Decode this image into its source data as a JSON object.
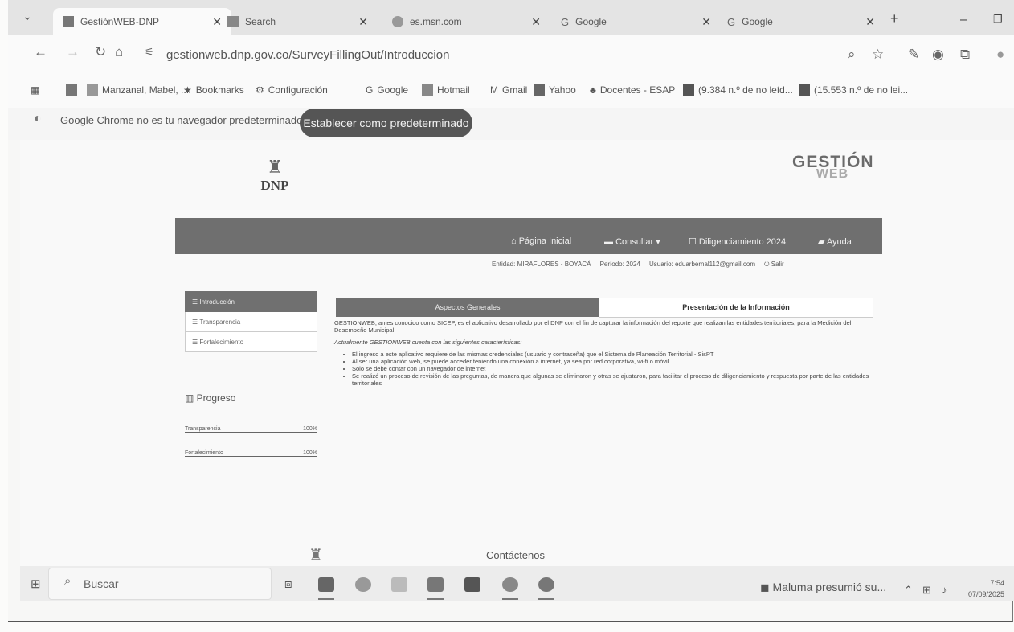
{
  "browser": {
    "tabs": [
      {
        "label": "GestiónWEB-DNP",
        "icon": "gestionweb-favicon"
      },
      {
        "label": "Search",
        "icon": "search-favicon"
      },
      {
        "label": "es.msn.com",
        "icon": "msn-favicon"
      },
      {
        "label": "Google",
        "icon": "google-favicon"
      },
      {
        "label": "Google",
        "icon": "google-favicon"
      }
    ],
    "url": "gestionweb.dnp.gov.co/SurveyFillingOut/Introduccion",
    "bookmarks": [
      "Manzanal, Mabel, ...",
      "Bookmarks",
      "Configuración",
      "Google",
      "Hotmail",
      "Gmail",
      "Yahoo",
      "Docentes - ESAP",
      "(9.384 n.º de no leíd...",
      "(15.553 n.º de no lei..."
    ],
    "infobar_text": "Google Chrome no es tu navegador predeterminado",
    "infobar_button": "Establecer como predeterminado"
  },
  "site": {
    "dnp_logo_text": "DNP",
    "gw_logo_line1": "GESTIÓN",
    "gw_logo_line2": "WEB",
    "nav": [
      "Página Inicial",
      "Consultar",
      "Diligenciamiento 2024",
      "Ayuda"
    ],
    "status": {
      "entity": "Entidad: MIRAFLORES - BOYACÁ",
      "period": "Período: 2024",
      "user": "Usuario: eduarbernal112@gmail.com",
      "logout": "Salir"
    },
    "sidebar": [
      "Introducción",
      "Transparencia",
      "Fortalecimiento"
    ],
    "progress_title": "Progreso",
    "progress": [
      {
        "label": "Transparencia",
        "value": "100%"
      },
      {
        "label": "Fortalecimiento",
        "value": "100%"
      }
    ],
    "content_tabs": [
      "Aspectos Generales",
      "Presentación de la Información"
    ],
    "intro": "GESTIONWEB, antes conocido como SICEP, es el aplicativo desarrollado por el DNP con el fin de capturar la información del reporte que realizan las entidades territoriales, para la Medición del Desempeño Municipal",
    "features_title": "Actualmente GESTIONWEB cuenta con las siguientes características:",
    "features": [
      "El ingreso a este aplicativo requiere de las mismas credenciales (usuario y contraseña) que el Sistema de Planeación Territorial - SisPT",
      "Al ser una aplicación web, se puede acceder teniendo una conexión a internet, ya sea por red corporativa, wi-fi o móvil",
      "Solo se debe contar con un navegador de internet",
      "Se realizó un proceso de revisión de las preguntas, de manera que algunas se eliminaron y otras se ajustaron, para facilitar el proceso de diligenciamiento y respuesta por parte de las entidades territoriales"
    ],
    "footer_link": "Contáctenos"
  },
  "taskbar": {
    "search_placeholder": "Buscar",
    "notification": "Maluma presumió su...",
    "time": "7:54",
    "date": "07/09/2025"
  }
}
